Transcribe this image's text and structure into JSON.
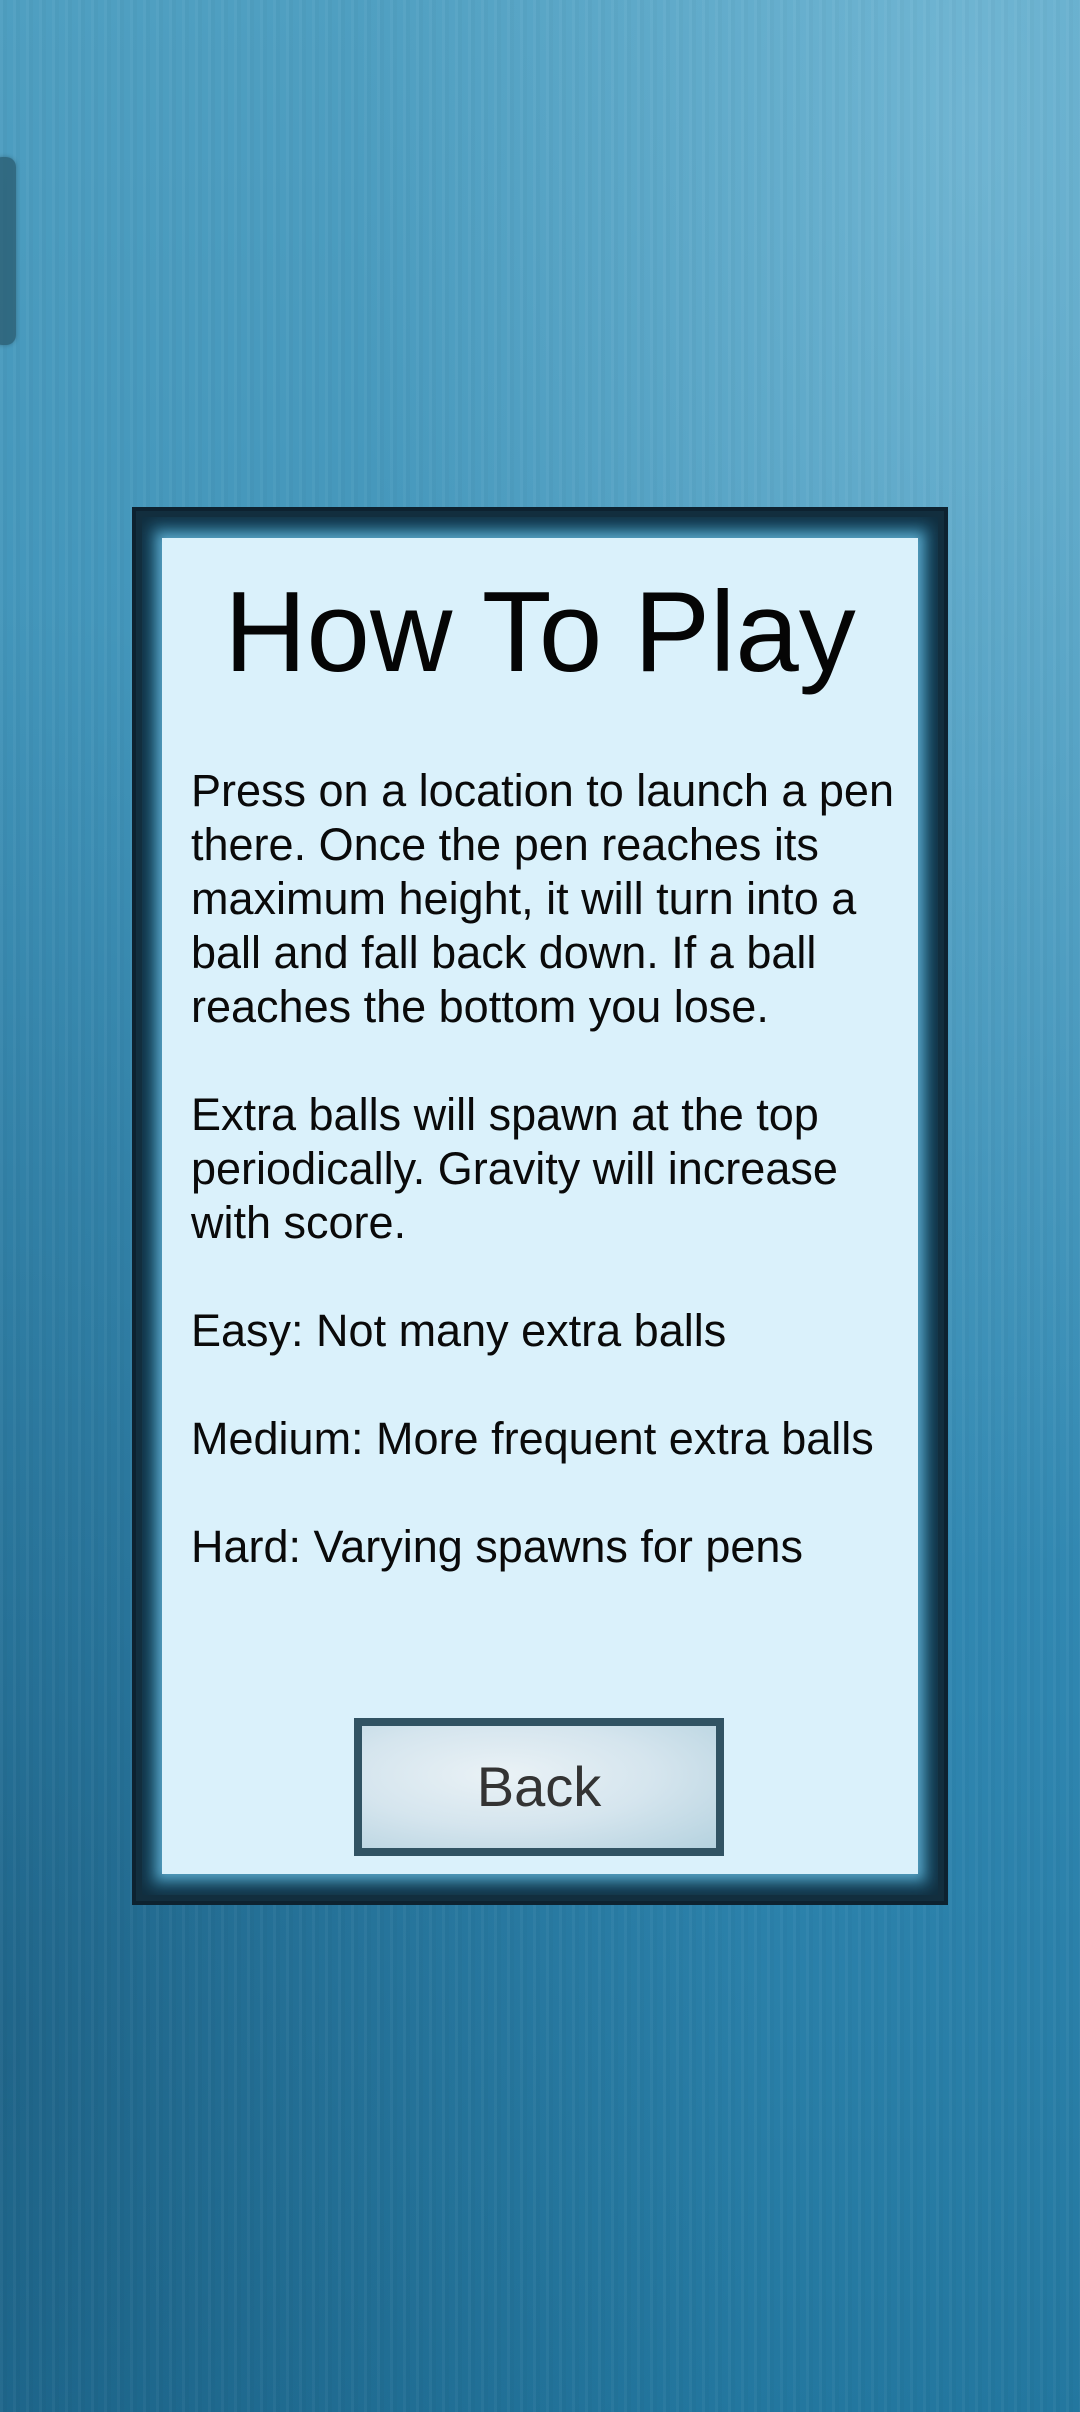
{
  "screen": {
    "title": "How To Play",
    "paragraphs": [
      "Press on a location to launch a pen there. Once the pen reaches its maximum height, it will turn into a ball and fall back down. If a ball reaches the bottom you lose.",
      "Extra balls will spawn at the top periodically. Gravity will increase with score.",
      "Easy: Not many extra balls",
      "Medium: More frequent extra balls",
      "Hard: Varying spawns for pens"
    ],
    "back_label": "Back"
  },
  "colors": {
    "background": "#3f93b9",
    "panel_frame": "#122e3e",
    "panel_fill": "#daf1fb",
    "button_border": "#315363"
  }
}
